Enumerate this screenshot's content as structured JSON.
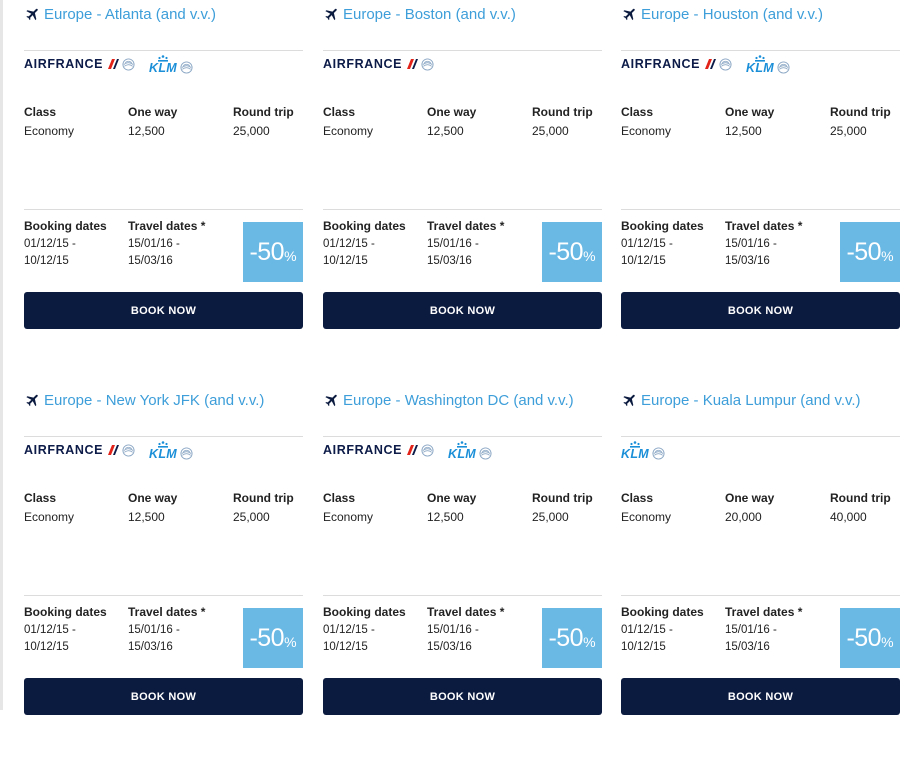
{
  "colors": {
    "accent": "#3d9ed9",
    "navy": "#0b1a3f",
    "discount_bg": "#6ab8e4",
    "af_red": "#e2231a",
    "klm_blue": "#1b8fd8"
  },
  "icons": {
    "route": "plane-icon",
    "airline_emblem": "skyteam-icon",
    "klm_crown": "crown-icon"
  },
  "headers": {
    "class": "Class",
    "one_way": "One way",
    "round_trip": "Round trip",
    "booking_dates": "Booking dates",
    "travel_dates": "Travel dates *"
  },
  "logos": {
    "airfrance": "AIRFRANCE",
    "klm": "KLM"
  },
  "discount": {
    "value": "-50",
    "unit": "%"
  },
  "button": {
    "label": "BOOK NOW"
  },
  "cards": [
    {
      "title": "Europe - Atlanta (and v.v.)",
      "airlines": [
        "AIRFRANCE",
        "KLM"
      ],
      "class": "Economy",
      "one_way": "12,500",
      "round_trip": "25,000",
      "booking_from": "01/12/15 -",
      "booking_to": "10/12/15",
      "travel_from": "15/01/16 -",
      "travel_to": "15/03/16"
    },
    {
      "title": "Europe - Boston (and v.v.)",
      "airlines": [
        "AIRFRANCE"
      ],
      "class": "Economy",
      "one_way": "12,500",
      "round_trip": "25,000",
      "booking_from": "01/12/15 -",
      "booking_to": "10/12/15",
      "travel_from": "15/01/16 -",
      "travel_to": "15/03/16"
    },
    {
      "title": "Europe - Houston (and v.v.)",
      "airlines": [
        "AIRFRANCE",
        "KLM"
      ],
      "class": "Economy",
      "one_way": "12,500",
      "round_trip": "25,000",
      "booking_from": "01/12/15 -",
      "booking_to": "10/12/15",
      "travel_from": "15/01/16 -",
      "travel_to": "15/03/16"
    },
    {
      "title": "Europe - New York JFK (and v.v.)",
      "airlines": [
        "AIRFRANCE",
        "KLM"
      ],
      "class": "Economy",
      "one_way": "12,500",
      "round_trip": "25,000",
      "booking_from": "01/12/15 -",
      "booking_to": "10/12/15",
      "travel_from": "15/01/16 -",
      "travel_to": "15/03/16"
    },
    {
      "title": "Europe - Washington DC (and v.v.)",
      "airlines": [
        "AIRFRANCE",
        "KLM"
      ],
      "class": "Economy",
      "one_way": "12,500",
      "round_trip": "25,000",
      "booking_from": "01/12/15 -",
      "booking_to": "10/12/15",
      "travel_from": "15/01/16 -",
      "travel_to": "15/03/16"
    },
    {
      "title": "Europe - Kuala Lumpur (and v.v.)",
      "airlines": [
        "KLM"
      ],
      "class": "Economy",
      "one_way": "20,000",
      "round_trip": "40,000",
      "booking_from": "01/12/15 -",
      "booking_to": "10/12/15",
      "travel_from": "15/01/16 -",
      "travel_to": "15/03/16"
    }
  ]
}
